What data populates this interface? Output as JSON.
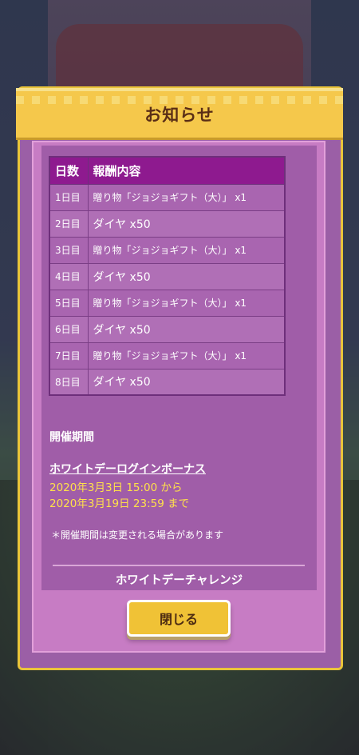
{
  "dialog": {
    "title": "お知らせ",
    "close_label": "閉じる"
  },
  "table": {
    "headers": {
      "day": "日数",
      "reward": "報酬内容"
    },
    "rows": [
      {
        "day": "1日目",
        "reward": "贈り物「ジョジョギフト（大）」 x1"
      },
      {
        "day": "2日目",
        "reward": "ダイヤ x50"
      },
      {
        "day": "3日目",
        "reward": "贈り物「ジョジョギフト（大）」 x1"
      },
      {
        "day": "4日目",
        "reward": "ダイヤ x50"
      },
      {
        "day": "5日目",
        "reward": "贈り物「ジョジョギフト（大）」 x1"
      },
      {
        "day": "6日目",
        "reward": "ダイヤ x50"
      },
      {
        "day": "7日目",
        "reward": "贈り物「ジョジョギフト（大）」 x1"
      },
      {
        "day": "8日目",
        "reward": "ダイヤ x50"
      }
    ]
  },
  "period": {
    "heading": "開催期間",
    "event_name": "ホワイトデーログインボーナス",
    "start": "2020年3月3日 15:00 から",
    "end": "2020年3月19日 23:59 まで",
    "note": "＊開催期間は変更される場合があります"
  },
  "next_section_title": "ホワイトデーチャレンジ",
  "colors": {
    "header_yellow": "#f5c84b",
    "panel_purple": "#9b5fa6",
    "table_header": "#8e1a8f",
    "date_yellow": "#ffe14a"
  }
}
